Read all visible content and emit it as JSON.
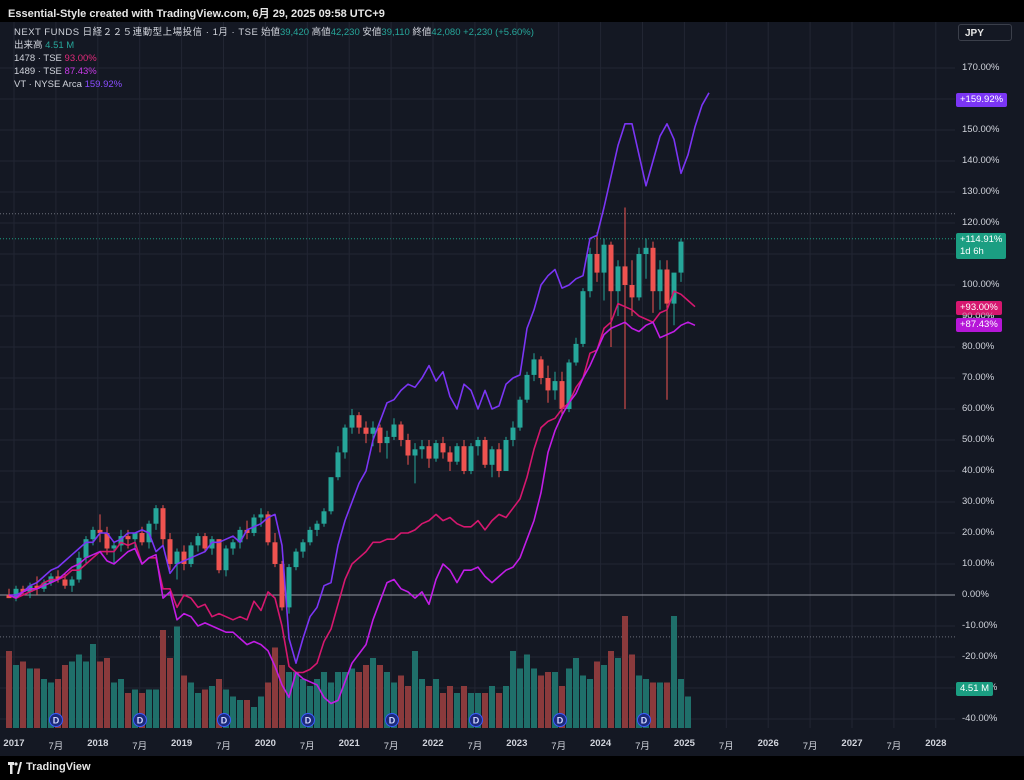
{
  "header": {
    "title": "Essential-Style created with TradingView.com, 6月 29, 2025 09:58 UTC+9"
  },
  "legend": {
    "symbol": "NEXT FUNDS 日経２２５連動型上場投信 · 1月 · TSE",
    "ohlc": [
      {
        "label": "始値",
        "value": "39,420"
      },
      {
        "label": "高値",
        "value": "42,230"
      },
      {
        "label": "安値",
        "value": "39,110"
      },
      {
        "label": "終値",
        "value": "42,080"
      }
    ],
    "change": "+2,230 (+5.60%)",
    "volume_label": "出来高",
    "volume_value": "4.51 M",
    "compare": [
      {
        "name": "1478 · TSE",
        "value": "93.00%"
      },
      {
        "name": "1489 · TSE",
        "value": "87.43%"
      },
      {
        "name": "VT · NYSE Arca",
        "value": "159.92%"
      }
    ]
  },
  "currency_button": "JPY",
  "y_ticks": [
    "170.00%",
    "160.00%",
    "150.00%",
    "140.00%",
    "130.00%",
    "120.00%",
    "110.00%",
    "100.00%",
    "90.00%",
    "80.00%",
    "70.00%",
    "60.00%",
    "50.00%",
    "40.00%",
    "30.00%",
    "20.00%",
    "10.00%",
    "0.00%",
    "-10.00%",
    "-20.00%",
    "-30.00%",
    "-40.00%"
  ],
  "badges": {
    "vt": "+159.92%",
    "main": "+114.91%",
    "countdown": "1d 6h",
    "s1478": "+93.00%",
    "s1489": "+87.43%",
    "volume": "4.51 M",
    "behind_tick": "90.00%"
  },
  "x_ticks": [
    "2017",
    "7月",
    "2018",
    "7月",
    "2019",
    "7月",
    "2020",
    "7月",
    "2021",
    "7月",
    "2022",
    "7月",
    "2023",
    "7月",
    "2024",
    "7月",
    "2025",
    "7月",
    "2026",
    "7月",
    "2027",
    "7月",
    "2028"
  ],
  "dividend_marker": "D",
  "footer": {
    "brand": "TradingView"
  },
  "colors": {
    "background": "#141823",
    "up": "#26a69a",
    "down": "#ef5350",
    "vt": "#7b35f5",
    "s1478": "#d6176f",
    "s1489": "#c21de6",
    "main_badge": "#1b9e82"
  },
  "chart_data": {
    "type": "candlestick",
    "title": "NEXT FUNDS 日経２２５連動型上場投信 · 1月 · TSE",
    "x_range": [
      "2017-01",
      "2028-01"
    ],
    "y_unit": "% change",
    "ylim": [
      -40,
      170
    ],
    "start": "2017-01",
    "main_ohlc_pct": [
      [
        0,
        2,
        -1,
        -1
      ],
      [
        -1,
        3,
        -2,
        2
      ],
      [
        2,
        3,
        0,
        1
      ],
      [
        1,
        4,
        -1,
        3
      ],
      [
        3,
        6,
        0,
        2
      ],
      [
        2,
        5,
        1,
        4
      ],
      [
        4,
        7,
        3,
        6
      ],
      [
        6,
        8,
        4,
        5
      ],
      [
        5,
        7,
        2,
        3
      ],
      [
        3,
        6,
        1,
        5
      ],
      [
        5,
        14,
        4,
        12
      ],
      [
        12,
        19,
        10,
        18
      ],
      [
        18,
        22,
        16,
        21
      ],
      [
        21,
        26,
        17,
        20
      ],
      [
        20,
        22,
        13,
        15
      ],
      [
        15,
        17,
        10,
        16
      ],
      [
        16,
        21,
        14,
        19
      ],
      [
        19,
        21,
        15,
        18
      ],
      [
        18,
        20,
        15,
        20
      ],
      [
        20,
        22,
        16,
        17
      ],
      [
        17,
        24,
        15,
        23
      ],
      [
        23,
        29,
        21,
        28
      ],
      [
        28,
        29,
        16,
        18
      ],
      [
        18,
        20,
        8,
        10
      ],
      [
        10,
        15,
        5,
        14
      ],
      [
        14,
        16,
        8,
        10
      ],
      [
        10,
        17,
        9,
        16
      ],
      [
        16,
        20,
        14,
        19
      ],
      [
        19,
        20,
        14,
        15
      ],
      [
        15,
        19,
        13,
        18
      ],
      [
        18,
        18,
        7,
        8
      ],
      [
        8,
        16,
        6,
        15
      ],
      [
        15,
        18,
        13,
        17
      ],
      [
        17,
        22,
        15,
        21
      ],
      [
        21,
        24,
        18,
        20
      ],
      [
        20,
        26,
        19,
        25
      ],
      [
        25,
        28,
        22,
        26
      ],
      [
        26,
        27,
        16,
        17
      ],
      [
        17,
        20,
        9,
        10
      ],
      [
        10,
        11,
        -5,
        -4
      ],
      [
        -4,
        10,
        -6,
        9
      ],
      [
        9,
        15,
        8,
        14
      ],
      [
        14,
        18,
        12,
        17
      ],
      [
        17,
        22,
        16,
        21
      ],
      [
        21,
        24,
        19,
        23
      ],
      [
        23,
        28,
        22,
        27
      ],
      [
        27,
        38,
        26,
        38
      ],
      [
        38,
        48,
        37,
        46
      ],
      [
        46,
        55,
        44,
        54
      ],
      [
        54,
        60,
        52,
        58
      ],
      [
        58,
        59,
        52,
        54
      ],
      [
        54,
        56,
        49,
        52
      ],
      [
        52,
        56,
        48,
        54
      ],
      [
        54,
        55,
        46,
        49
      ],
      [
        49,
        53,
        44,
        51
      ],
      [
        51,
        57,
        50,
        55
      ],
      [
        55,
        56,
        48,
        50
      ],
      [
        50,
        52,
        42,
        45
      ],
      [
        45,
        49,
        36,
        47
      ],
      [
        47,
        50,
        44,
        48
      ],
      [
        48,
        50,
        41,
        44
      ],
      [
        44,
        50,
        43,
        49
      ],
      [
        49,
        51,
        44,
        46
      ],
      [
        46,
        48,
        40,
        43
      ],
      [
        43,
        49,
        42,
        48
      ],
      [
        48,
        50,
        39,
        40
      ],
      [
        40,
        49,
        39,
        48
      ],
      [
        48,
        51,
        45,
        50
      ],
      [
        50,
        51,
        41,
        42
      ],
      [
        42,
        48,
        38,
        47
      ],
      [
        47,
        49,
        38,
        40
      ],
      [
        40,
        51,
        40,
        50
      ],
      [
        50,
        56,
        48,
        54
      ],
      [
        54,
        64,
        53,
        63
      ],
      [
        63,
        72,
        62,
        71
      ],
      [
        71,
        78,
        69,
        76
      ],
      [
        76,
        77,
        68,
        70
      ],
      [
        70,
        74,
        62,
        66
      ],
      [
        66,
        72,
        63,
        69
      ],
      [
        69,
        72,
        58,
        60
      ],
      [
        60,
        76,
        59,
        75
      ],
      [
        75,
        83,
        74,
        81
      ],
      [
        81,
        99,
        80,
        98
      ],
      [
        98,
        112,
        96,
        110
      ],
      [
        110,
        117,
        101,
        104
      ],
      [
        104,
        115,
        95,
        113
      ],
      [
        113,
        114,
        80,
        98
      ],
      [
        98,
        108,
        90,
        106
      ],
      [
        106,
        125,
        60,
        100
      ],
      [
        100,
        108,
        90,
        96
      ],
      [
        96,
        112,
        95,
        110
      ],
      [
        110,
        115,
        102,
        112
      ],
      [
        112,
        114,
        91,
        98
      ],
      [
        98,
        108,
        92,
        105
      ],
      [
        105,
        108,
        63,
        94
      ],
      [
        94,
        100,
        87,
        104
      ],
      [
        104,
        115,
        101,
        114
      ]
    ],
    "volume_m": [
      11,
      9,
      9.5,
      8.5,
      8.5,
      7,
      6.5,
      7,
      9,
      9.5,
      10.5,
      9.5,
      12,
      9.5,
      10,
      6.5,
      7,
      5,
      5.5,
      5,
      5.5,
      5.5,
      14,
      10,
      14.5,
      7.5,
      6.5,
      5,
      5.5,
      6,
      7,
      5.5,
      4.5,
      4,
      4,
      3,
      4.5,
      6.5,
      11.5,
      9,
      8,
      8,
      7,
      6,
      7,
      8,
      6.5,
      8,
      8,
      8.5,
      8,
      9,
      10,
      9,
      8,
      6.5,
      7.5,
      6,
      11,
      7,
      6,
      7,
      5,
      6,
      5,
      6,
      5,
      5,
      5,
      6,
      5,
      6,
      11,
      8.5,
      10.5,
      8.5,
      7.5,
      8,
      8,
      6,
      8.5,
      10,
      7.5,
      7,
      9.5,
      9,
      11,
      10,
      16,
      10.5,
      7.5,
      7,
      6.5,
      6.5,
      6.5,
      16,
      7,
      4.5
    ],
    "series": [
      {
        "name": "VT · NYSE Arca",
        "values": [
          0,
          0,
          1,
          3,
          4,
          6,
          8,
          9,
          11,
          13,
          15,
          17,
          17,
          20,
          20,
          17,
          18,
          20,
          20,
          21,
          20,
          14,
          16,
          7,
          10,
          11,
          12,
          13,
          14,
          17,
          17,
          18,
          19,
          17,
          21,
          22,
          23,
          25,
          26,
          16,
          -14,
          -22,
          -14,
          -7,
          -4,
          3,
          4,
          16,
          24,
          30,
          36,
          40,
          50,
          56,
          62,
          63,
          66,
          68,
          67,
          70,
          74,
          69,
          72,
          64,
          60,
          68,
          66,
          60,
          66,
          60,
          61,
          68,
          70,
          71,
          86,
          92,
          100,
          103,
          105,
          99,
          100,
          102,
          103,
          115,
          116,
          125,
          135,
          145,
          152,
          152,
          142,
          132,
          140,
          148,
          152,
          147,
          136,
          142,
          151,
          158,
          162
        ]
      },
      {
        "name": "1478 · TSE",
        "values": [
          0,
          -1,
          0,
          1,
          2,
          4,
          5,
          5,
          6,
          8,
          8,
          10,
          12,
          14,
          14,
          14,
          17,
          16,
          17,
          10,
          12,
          12,
          2,
          2,
          -4,
          0,
          -1,
          -4,
          -3,
          -7,
          -6,
          -7,
          -8,
          -7,
          -8,
          -2,
          -5,
          1,
          -1,
          -10,
          -23,
          -25,
          -25,
          -24,
          -22,
          -15,
          -11,
          -3,
          5,
          10,
          12,
          14,
          17,
          17,
          18,
          18,
          20,
          20,
          21,
          23,
          24,
          26,
          24,
          25,
          23,
          22,
          22,
          24,
          21,
          24,
          26,
          25,
          28,
          31,
          38,
          47,
          54,
          56,
          57,
          60,
          62,
          67,
          70,
          78,
          79,
          86,
          88,
          94,
          93,
          92,
          90,
          89,
          88,
          91,
          92,
          98,
          97,
          95,
          93
        ]
      },
      {
        "name": "1489 · TSE",
        "values": [
          0,
          -1,
          1,
          2,
          2,
          3,
          4,
          5,
          7,
          9,
          10,
          12,
          13,
          14,
          11,
          10,
          12,
          14,
          15,
          10,
          12,
          13,
          -1,
          1,
          -8,
          -6,
          -7,
          -10,
          -9,
          -10,
          -11,
          -12,
          -12,
          -14,
          -16,
          -15,
          -16,
          -18,
          -23,
          -29,
          -33,
          -25,
          -27,
          -28,
          -29,
          -33,
          -35,
          -34,
          -28,
          -22,
          -19,
          -16,
          -8,
          -2,
          4,
          5,
          2,
          1,
          -1,
          1,
          -3,
          5,
          10,
          8,
          4,
          8,
          8,
          9,
          6,
          4,
          6,
          8,
          9,
          12,
          18,
          24,
          33,
          46,
          53,
          58,
          62,
          65,
          70,
          74,
          79,
          84,
          86,
          87,
          88,
          86,
          85,
          87,
          88,
          83,
          84,
          85,
          87,
          88,
          87
        ]
      }
    ]
  }
}
